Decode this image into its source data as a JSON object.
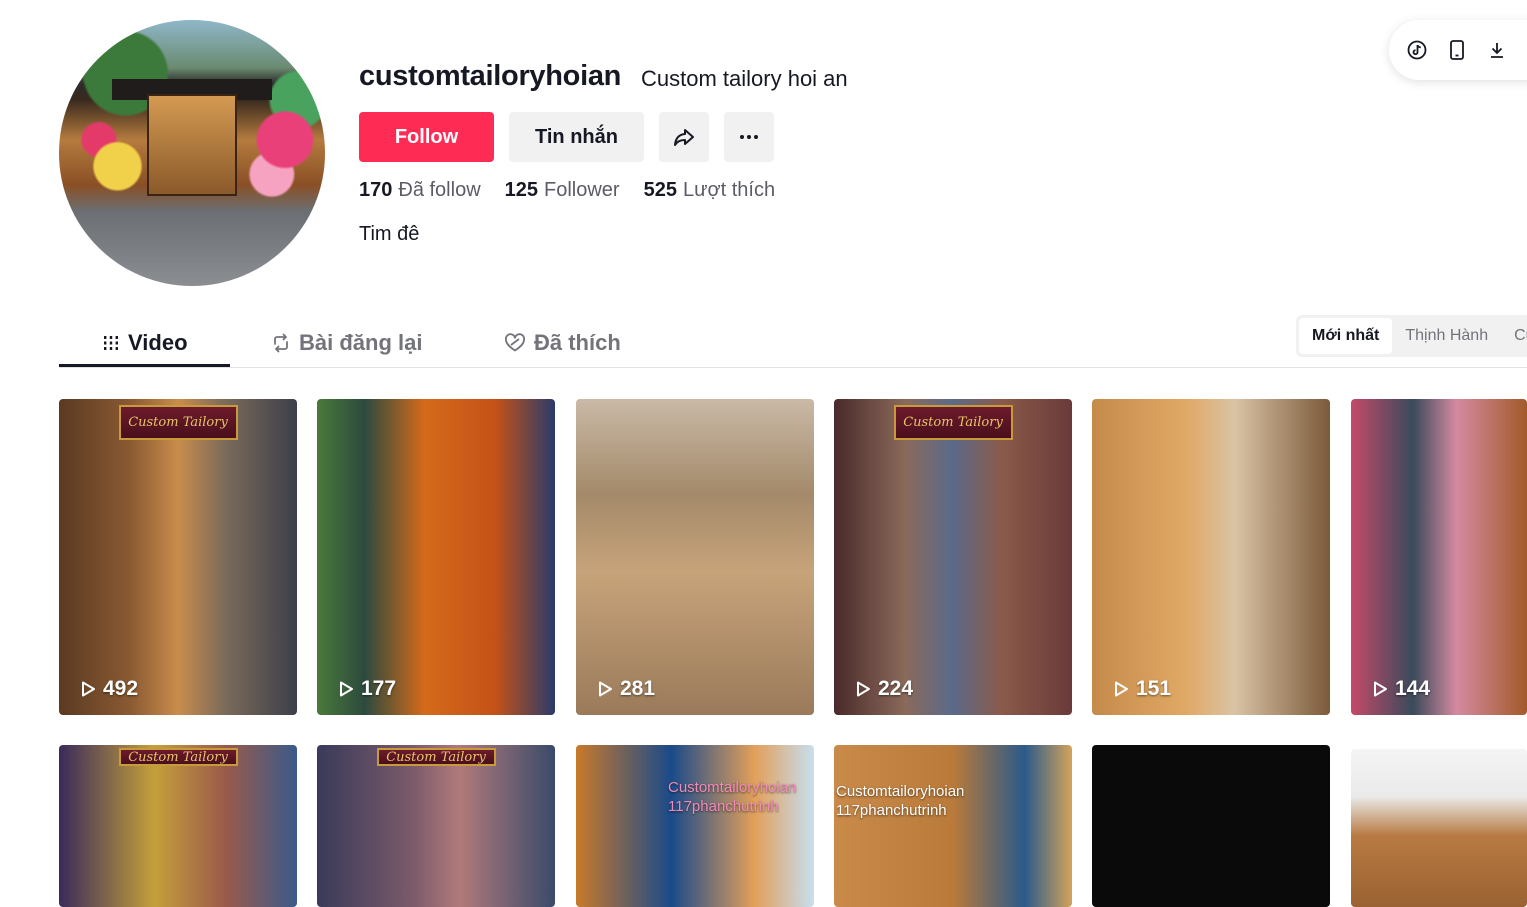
{
  "profile": {
    "username": "customtailoryhoian",
    "nickname": "Custom tailory hoi an",
    "bio": "Tim đê",
    "stats": [
      {
        "value": "170",
        "label": "Đã follow"
      },
      {
        "value": "125",
        "label": "Follower"
      },
      {
        "value": "525",
        "label": "Lượt thích"
      }
    ]
  },
  "actions": {
    "follow_label": "Follow",
    "message_label": "Tin nhắn",
    "share_icon": "share-icon",
    "more_icon": "more-icon"
  },
  "toolbox": {
    "icons": [
      "tiktok-icon",
      "phone-icon",
      "download-icon"
    ]
  },
  "tabs": [
    {
      "label": "Video",
      "icon": "grid-icon",
      "active": true
    },
    {
      "label": "Bài đăng lại",
      "icon": "repost-icon",
      "active": false
    },
    {
      "label": "Đã thích",
      "icon": "heart-icon",
      "active": false
    }
  ],
  "sort": {
    "options": [
      "Mới nhất",
      "Thịnh Hành",
      "Cũ nhất"
    ],
    "selected": "Mới nhất"
  },
  "videos": [
    {
      "views": "492",
      "sign": "Custom Tailory"
    },
    {
      "views": "177"
    },
    {
      "views": "281"
    },
    {
      "views": "224",
      "sign": "Custom Tailory"
    },
    {
      "views": "151"
    },
    {
      "views": "144"
    }
  ],
  "videos_row2": [
    {
      "sign": "Custom Tailory"
    },
    {
      "sign": "Custom Tailory"
    },
    {
      "overlay": "Customtailoryhoian\n117phanchutrinh"
    },
    {
      "overlay": "Customtailoryhoian\n117phanchutrinh"
    },
    {},
    {}
  ],
  "colors": {
    "accent": "#fe2c55",
    "text": "#161823",
    "muted": "#73747b",
    "button_bg": "#f1f1f2"
  }
}
